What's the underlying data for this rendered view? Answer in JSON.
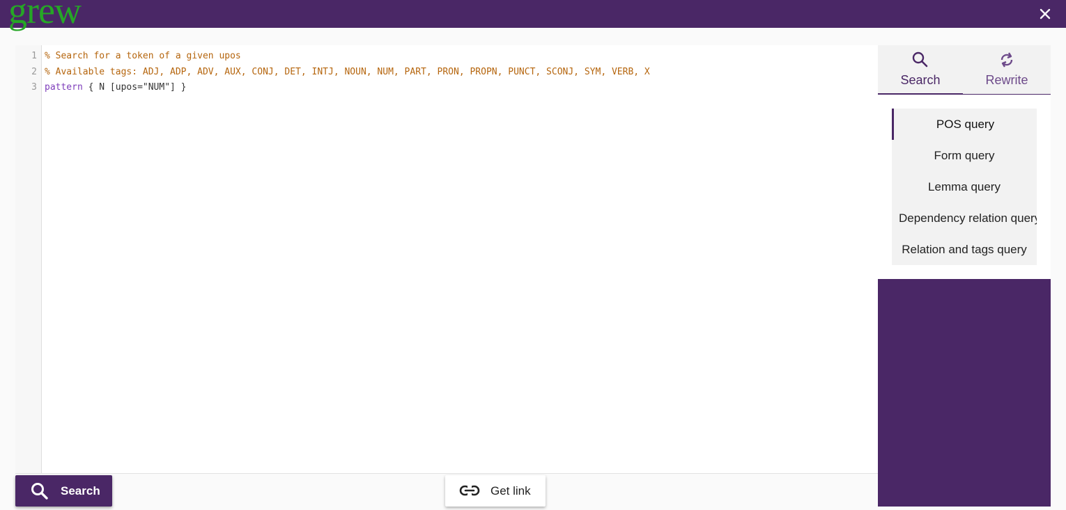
{
  "app": {
    "logo_text": "grew"
  },
  "editor": {
    "line_numbers": [
      "1",
      "2",
      "3"
    ],
    "lines": [
      "% Search for a token of a given upos",
      "% Available tags: ADJ, ADP, ADV, AUX, CONJ, DET, INTJ, NOUN, NUM, PART, PRON, PROPN, PUNCT, SCONJ, SYM, VERB, X",
      {
        "keyword": "pattern",
        "rest": " { N [upos=\"NUM\"] }"
      }
    ]
  },
  "footer": {
    "search_label": "Search",
    "get_link_label": "Get link"
  },
  "panel": {
    "tabs": [
      {
        "label": "Search",
        "icon": "search-icon",
        "active": true
      },
      {
        "label": "Rewrite",
        "icon": "refresh-icon",
        "active": false
      }
    ],
    "queries": [
      {
        "label": "POS query",
        "active": true
      },
      {
        "label": "Form query",
        "active": false
      },
      {
        "label": "Lemma query",
        "active": false
      },
      {
        "label": "Dependency relation query",
        "active": false
      },
      {
        "label": "Relation and tags query",
        "active": false
      }
    ]
  },
  "colors": {
    "brand_purple": "#4a2766",
    "logo_green": "#26a626",
    "comment_orange": "#b5650d",
    "keyword_purple": "#7d3cba"
  }
}
